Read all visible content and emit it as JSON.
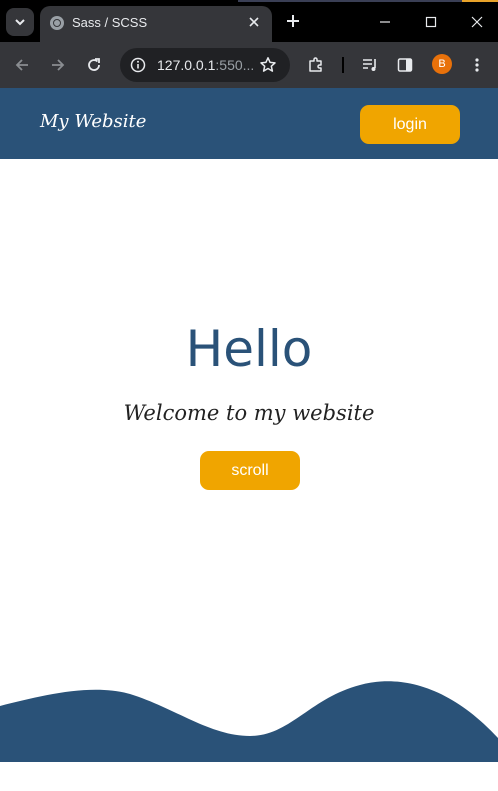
{
  "browser": {
    "tab_title": "Sass / SCSS",
    "url_host": "127.0.0.1",
    "url_rest": ":550...",
    "profile_initial": "B"
  },
  "header": {
    "logo_text": "My Website",
    "login_label": "login"
  },
  "hero": {
    "title": "Hello",
    "subtitle": "Welcome to my website",
    "scroll_label": "scroll"
  },
  "colors": {
    "brand_blue": "#2a5278",
    "accent_orange": "#f0a500"
  }
}
